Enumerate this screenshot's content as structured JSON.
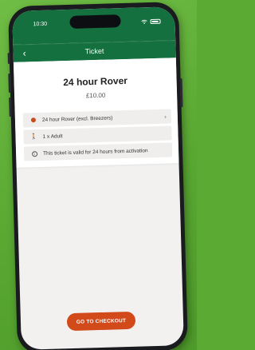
{
  "status": {
    "time": "10:30"
  },
  "nav": {
    "title": "Ticket",
    "back_icon": "chevron-left-icon"
  },
  "ticket": {
    "name": "24 hour Rover",
    "price": "£10.00",
    "rows": [
      {
        "icon": "dot-icon",
        "text": "24 hour Rover (excl. Breezers)",
        "has_chevron": true
      },
      {
        "icon": "person-icon",
        "text": "1 x Adult"
      },
      {
        "icon": "info-icon",
        "text": "This ticket is valid for 24 hours from activation"
      }
    ]
  },
  "checkout": {
    "label": "GO TO CHECKOUT"
  },
  "colors": {
    "brand_green": "#15703f",
    "accent_orange": "#d2491a",
    "background_green": "#5aaa34"
  }
}
